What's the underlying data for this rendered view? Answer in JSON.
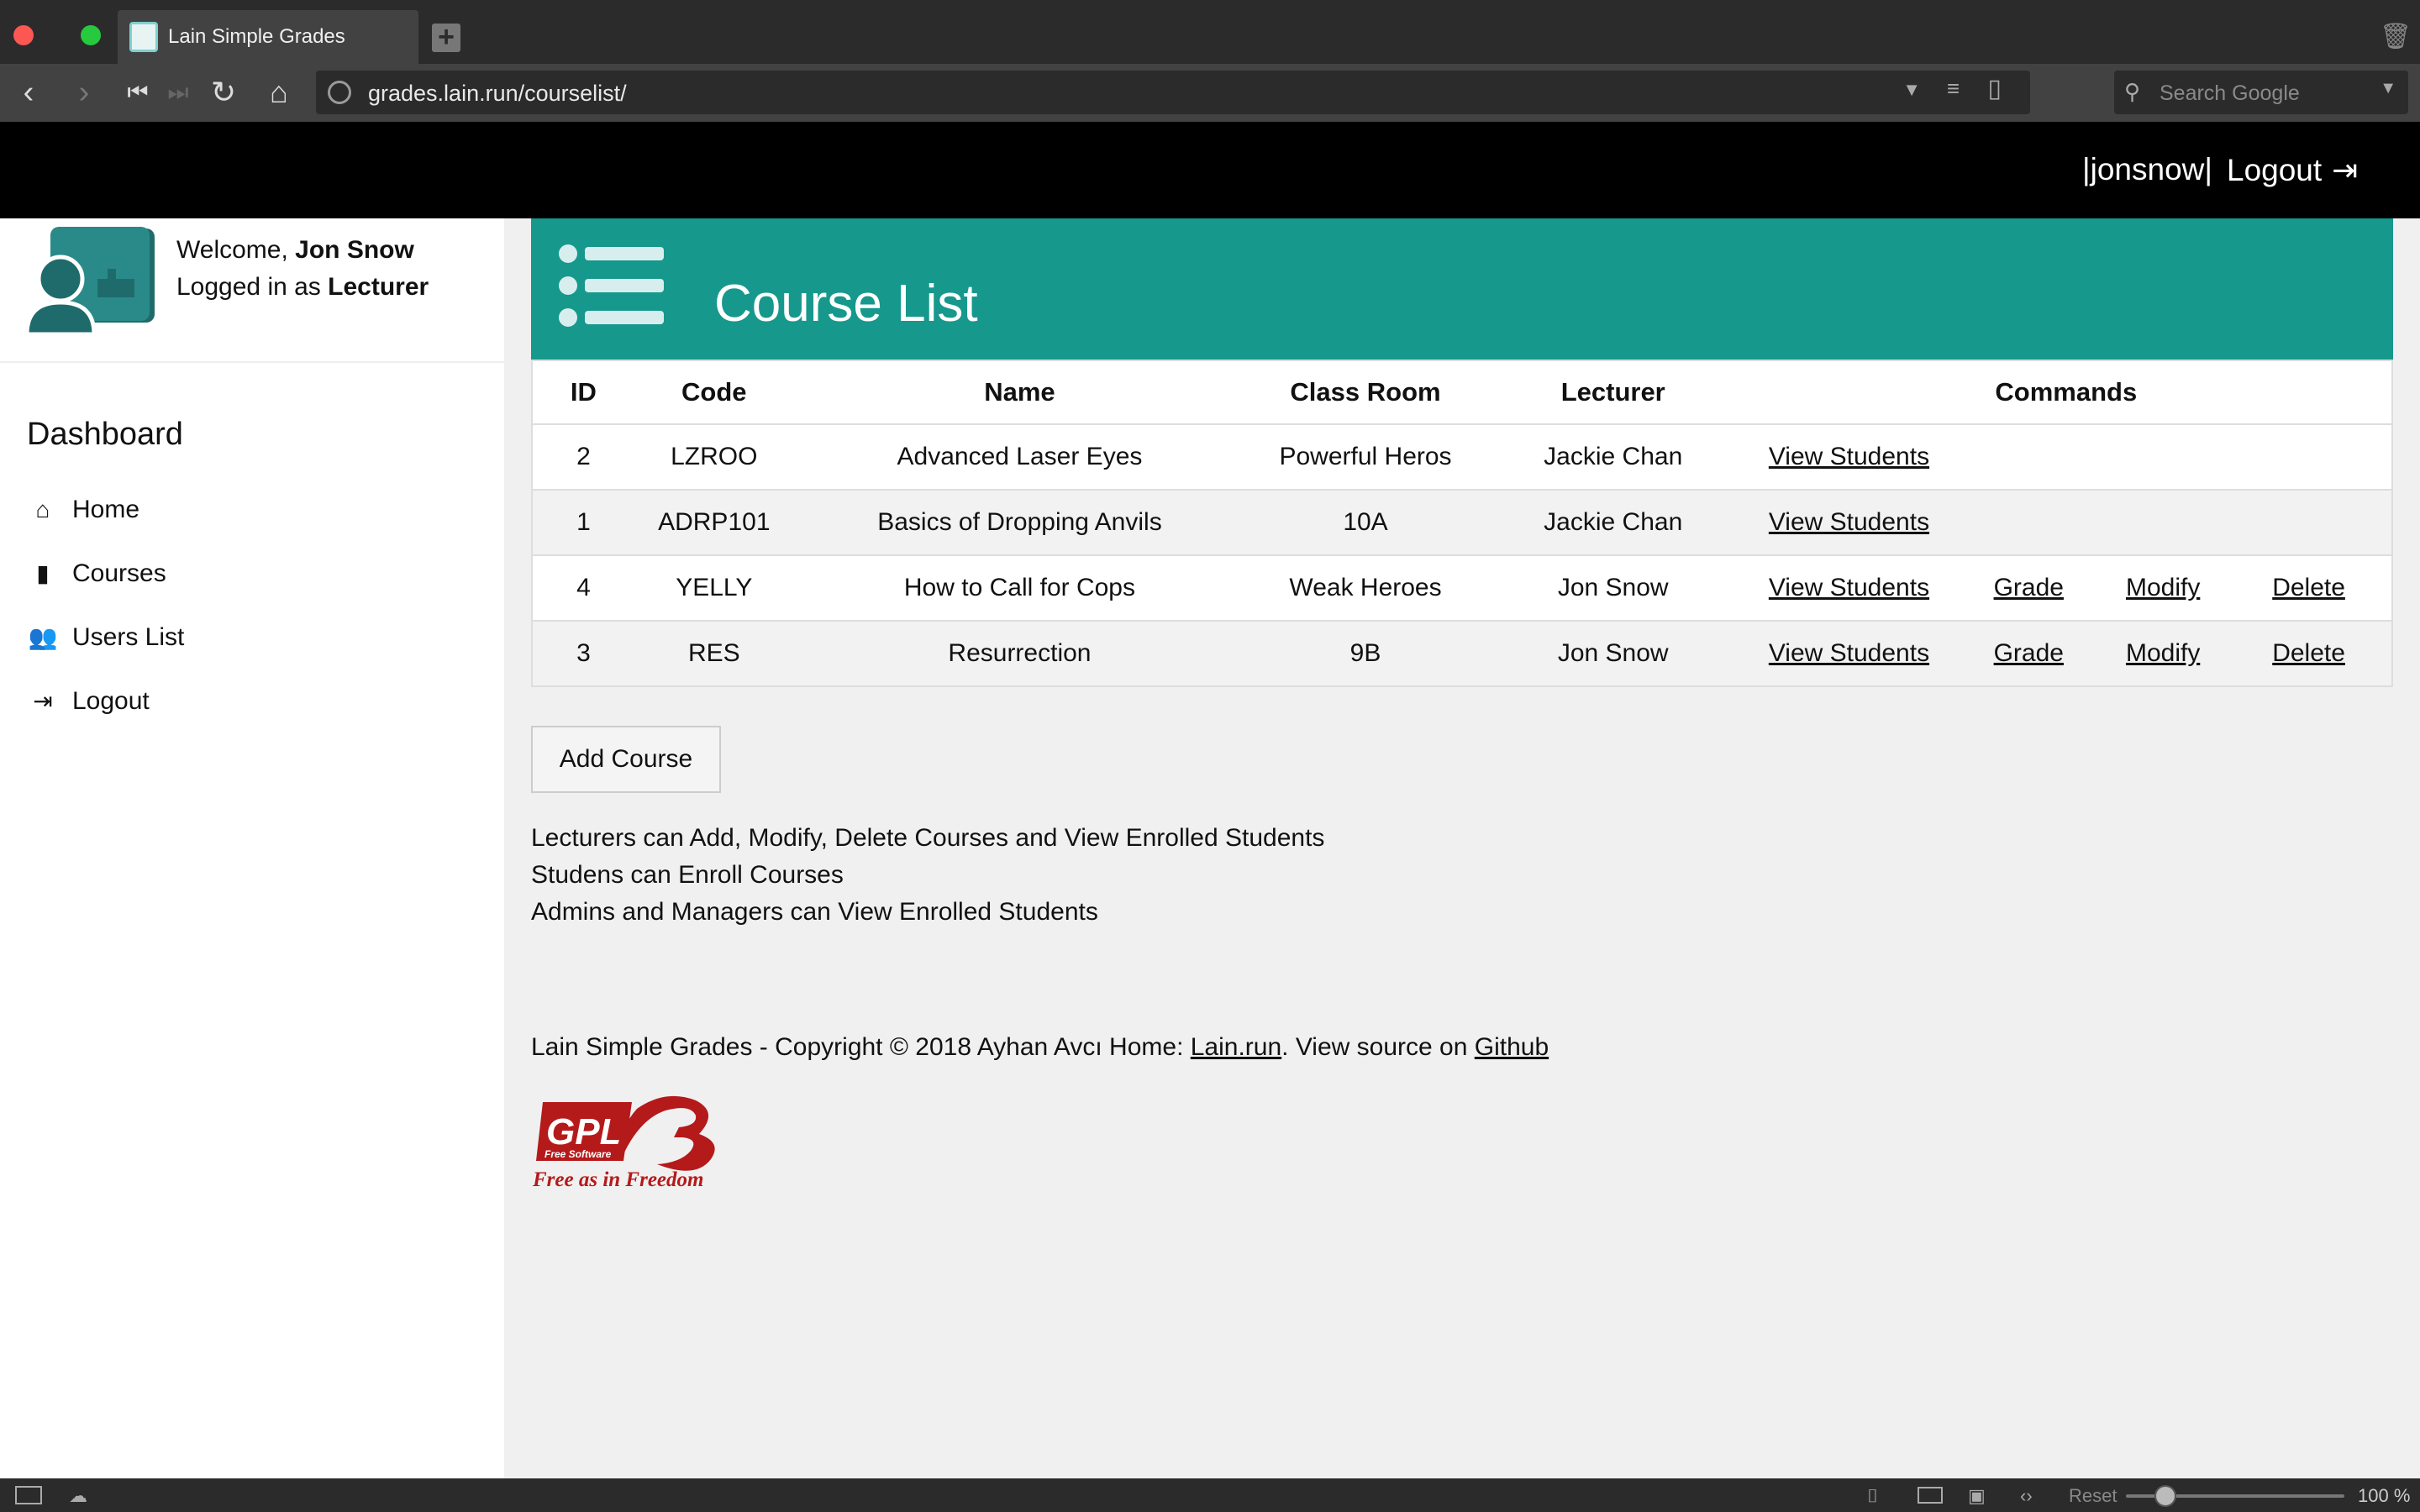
{
  "browser": {
    "tab_title": "Lain Simple Grades",
    "url": "grades.lain.run/courselist/",
    "search_placeholder": "Search Google",
    "zoom": "100 %",
    "reset_label": "Reset"
  },
  "topnav": {
    "username": "|jonsnow|",
    "logout_label": "Logout"
  },
  "sidebar": {
    "welcome_prefix": "Welcome,",
    "welcome_name": "Jon Snow",
    "role_prefix": "Logged in as",
    "role": "Lecturer",
    "dashboard_title": "Dashboard",
    "items": [
      {
        "label": "Home",
        "icon": "home-icon"
      },
      {
        "label": "Courses",
        "icon": "book-icon"
      },
      {
        "label": "Users List",
        "icon": "users-icon"
      },
      {
        "label": "Logout",
        "icon": "sign-out-icon"
      }
    ]
  },
  "main": {
    "title": "Course List",
    "table": {
      "headers": [
        "ID",
        "Code",
        "Name",
        "Class Room",
        "Lecturer",
        "Commands"
      ],
      "rows": [
        {
          "id": "2",
          "code": "LZROO",
          "name": "Advanced Laser Eyes",
          "room": "Powerful Heros",
          "lecturer": "Jackie Chan",
          "view": "View Students",
          "grade": "",
          "modify": "",
          "delete": ""
        },
        {
          "id": "1",
          "code": "ADRP101",
          "name": "Basics of Dropping Anvils",
          "room": "10A",
          "lecturer": "Jackie Chan",
          "view": "View Students",
          "grade": "",
          "modify": "",
          "delete": ""
        },
        {
          "id": "4",
          "code": "YELLY",
          "name": "How to Call for Cops",
          "room": "Weak Heroes",
          "lecturer": "Jon Snow",
          "view": "View Students",
          "grade": "Grade",
          "modify": "Modify",
          "delete": "Delete"
        },
        {
          "id": "3",
          "code": "RES",
          "name": "Resurrection",
          "room": "9B",
          "lecturer": "Jon Snow",
          "view": "View Students",
          "grade": "Grade",
          "modify": "Modify",
          "delete": "Delete"
        }
      ]
    },
    "add_button": "Add Course",
    "notes": [
      "Lecturers can Add, Modify, Delete Courses and View Enrolled Students",
      "Studens can Enroll Courses",
      "Admins and Managers can View Enrolled Students"
    ],
    "footer": {
      "text_before": "Lain Simple Grades - Copyright © 2018 Ayhan Avcı Home: ",
      "home_link": "Lain.run",
      "text_middle": ". View source on ",
      "github_link": "Github"
    },
    "gpl_logo": {
      "mark": "GPLv3",
      "small": "Free Software",
      "tagline": "Free as in Freedom"
    }
  },
  "colors": {
    "accent": "#17988c",
    "topnav": "#000000",
    "browser_chrome": "#2b2b2b"
  }
}
